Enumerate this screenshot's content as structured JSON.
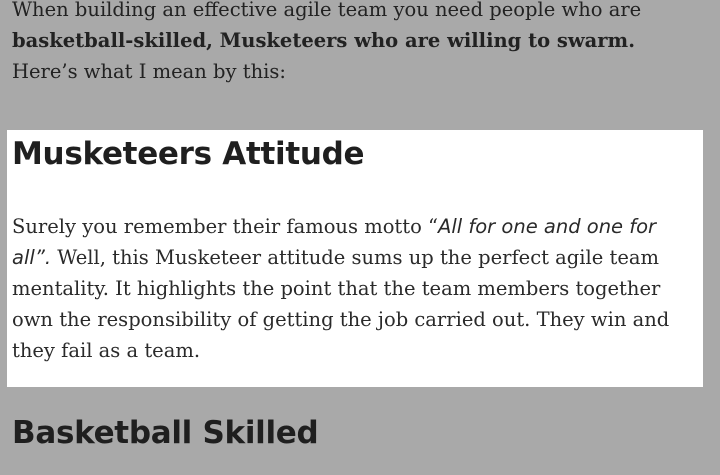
{
  "intro": {
    "line_start": "When building an effective agile team you need people who are ",
    "bold": "basketball-skilled, Musketeers who are willing to swarm.",
    "line_end": " Here’s what I mean by this:"
  },
  "section1": {
    "title": "Musketeers Attitude",
    "body_before_quote": "Surely you remember their famous motto “",
    "quote": "All for one and one for all”.",
    "body_after_quote": " Well, this Musketeer attitude sums up the perfect agile team mentality. It highlights the point that the team members together own the responsibility of getting the job carried out. They win and they fail as a team."
  },
  "section2": {
    "title": "Basketball Skilled"
  }
}
